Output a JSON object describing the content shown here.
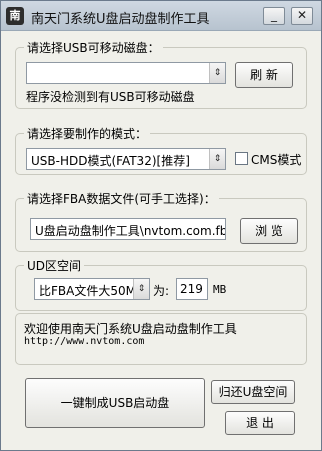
{
  "window": {
    "icon_text": "南",
    "title": "南天门系统U盘启动盘制作工具",
    "minimize_glyph": "_",
    "close_glyph": "✕"
  },
  "usb_group": {
    "label": "请选择USB可移动磁盘：",
    "selected": "",
    "refresh_label": "刷 新",
    "status": "程序没检测到有USB可移动磁盘"
  },
  "mode_group": {
    "label": "请选择要制作的模式：",
    "selected": "USB-HDD模式(FAT32)[推荐]",
    "cms_label": "CMS模式",
    "cms_checked": false
  },
  "fba_group": {
    "label": "请选择FBA数据文件(可手工选择)：",
    "path": "U盘启动盘制作工具\\nvtom.com.fba",
    "browse_label": "浏 览"
  },
  "ud_group": {
    "label": "UD区空间",
    "size_option": "比FBA文件大50M",
    "as_label": "为:",
    "size_value": "219",
    "unit": "MB"
  },
  "info": {
    "welcome": "欢迎使用南天门系统U盘启动盘制作工具",
    "url": "http://www.nvtom.com"
  },
  "actions": {
    "make_label": "一键制成USB启动盘",
    "restore_label": "归还U盘空间",
    "exit_label": "退  出"
  },
  "icons": {
    "dropdown": "chevron-updown-icon"
  }
}
